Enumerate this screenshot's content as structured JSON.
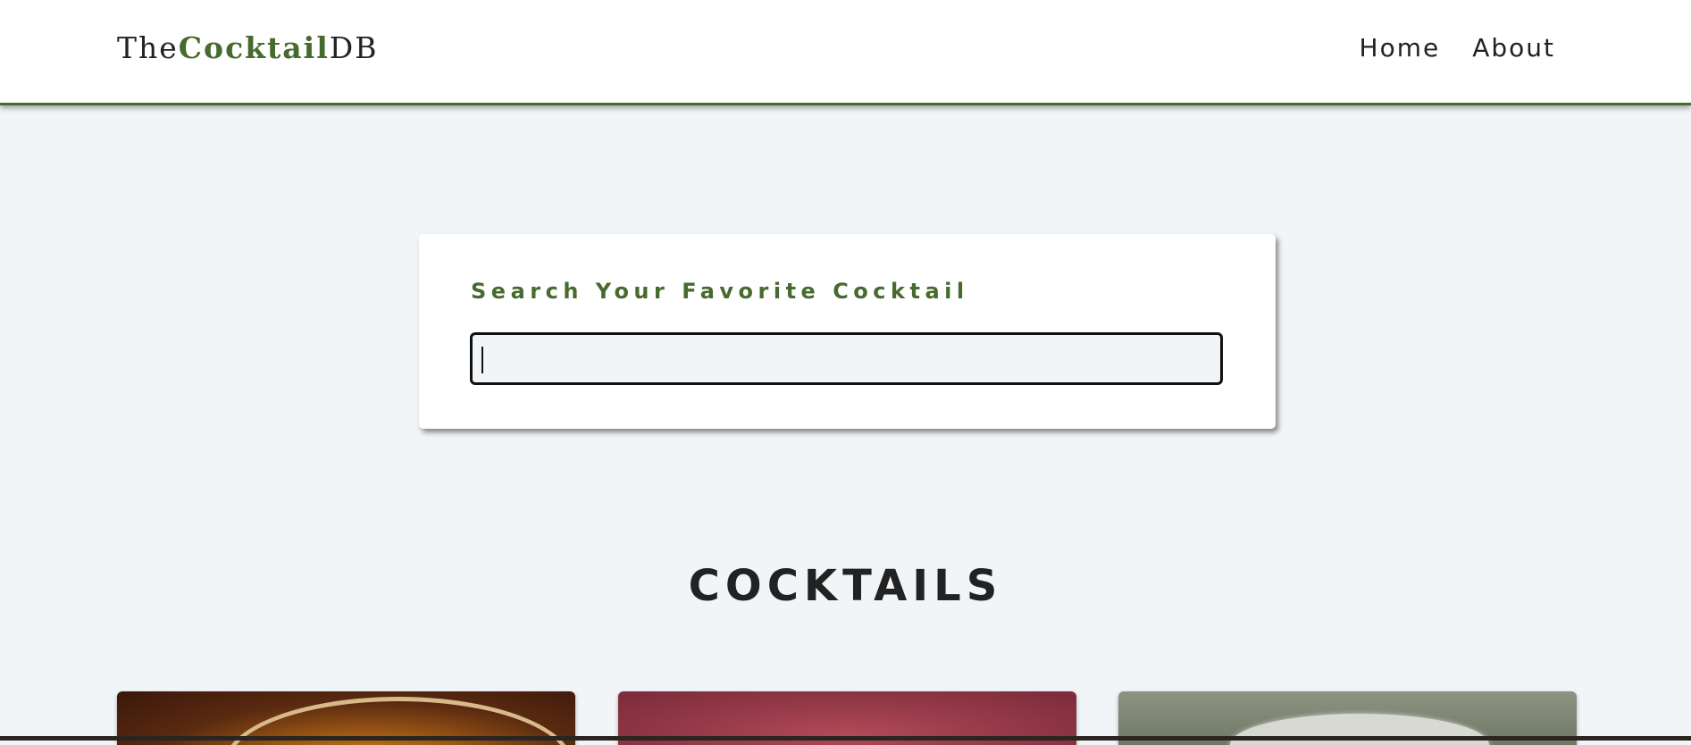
{
  "navbar": {
    "logo": {
      "prefix": "The",
      "accent": "Cocktail",
      "suffix": "DB"
    },
    "links": [
      {
        "label": "Home"
      },
      {
        "label": "About"
      }
    ]
  },
  "search": {
    "label": "Search Your Favorite Cocktail",
    "value": "",
    "placeholder": ""
  },
  "section": {
    "title": "COCKTAILS"
  },
  "colors": {
    "accent": "#476a2e",
    "background": "#f1f5f8",
    "text": "#222222"
  }
}
